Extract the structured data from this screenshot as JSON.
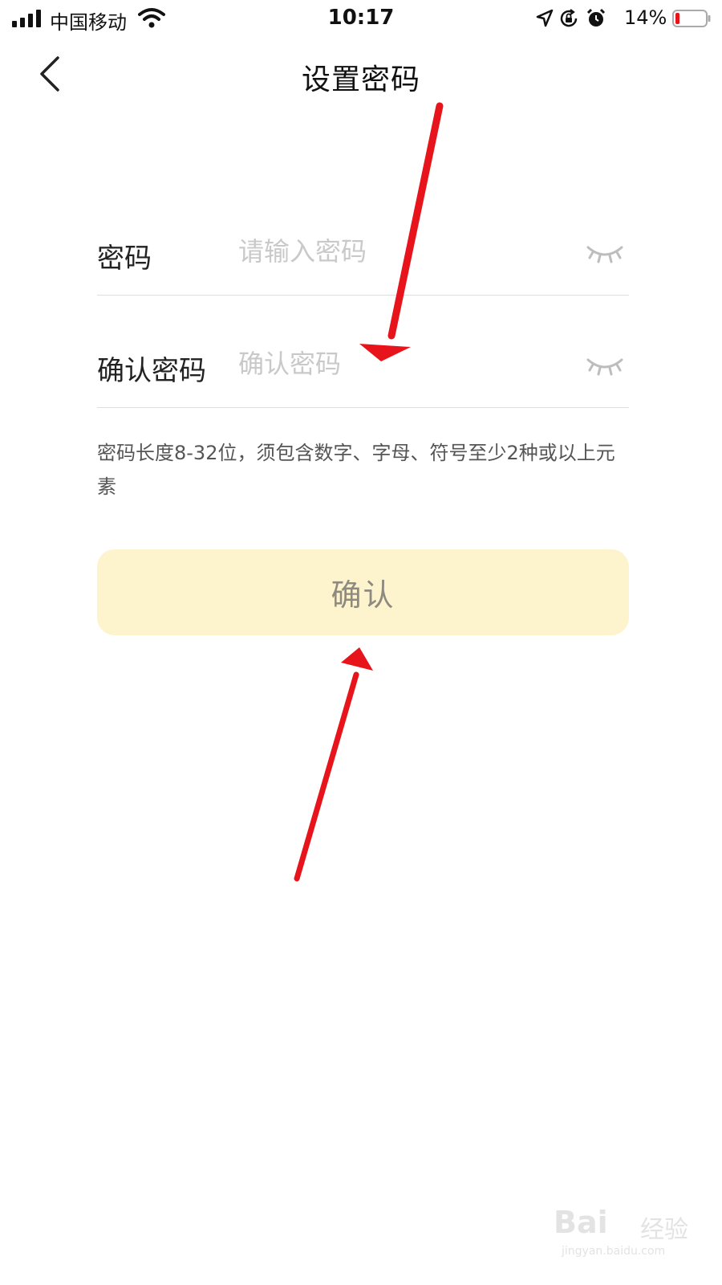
{
  "status_bar": {
    "carrier": "中国移动",
    "time": "10:17",
    "battery": "14%",
    "battery_level": 0.14,
    "icons": [
      "signal-icon",
      "wifi-icon",
      "location-icon",
      "orientation-lock-icon",
      "alarm-icon",
      "battery-icon"
    ]
  },
  "nav": {
    "title": "设置密码",
    "back_icon": "chevron-left-icon"
  },
  "form": {
    "password": {
      "label": "密码",
      "placeholder": "请输入密码",
      "value": "",
      "toggle_icon": "eye-closed-icon"
    },
    "confirm": {
      "label": "确认密码",
      "placeholder": "确认密码",
      "value": "",
      "toggle_icon": "eye-closed-icon"
    },
    "hint": "密码长度8-32位，须包含数字、字母、符号至少2种或以上元素"
  },
  "confirm_button": {
    "label": "确认"
  },
  "annotations": {
    "arrow_color": "#e8141c"
  },
  "watermark": {
    "logo": "Bai",
    "cn": "经验",
    "url": "jingyan.baidu.com"
  },
  "colors": {
    "button_bg": "#fdf3cd",
    "button_text": "#8e8a80",
    "placeholder": "#c9c9c9",
    "divider": "#dedede"
  }
}
